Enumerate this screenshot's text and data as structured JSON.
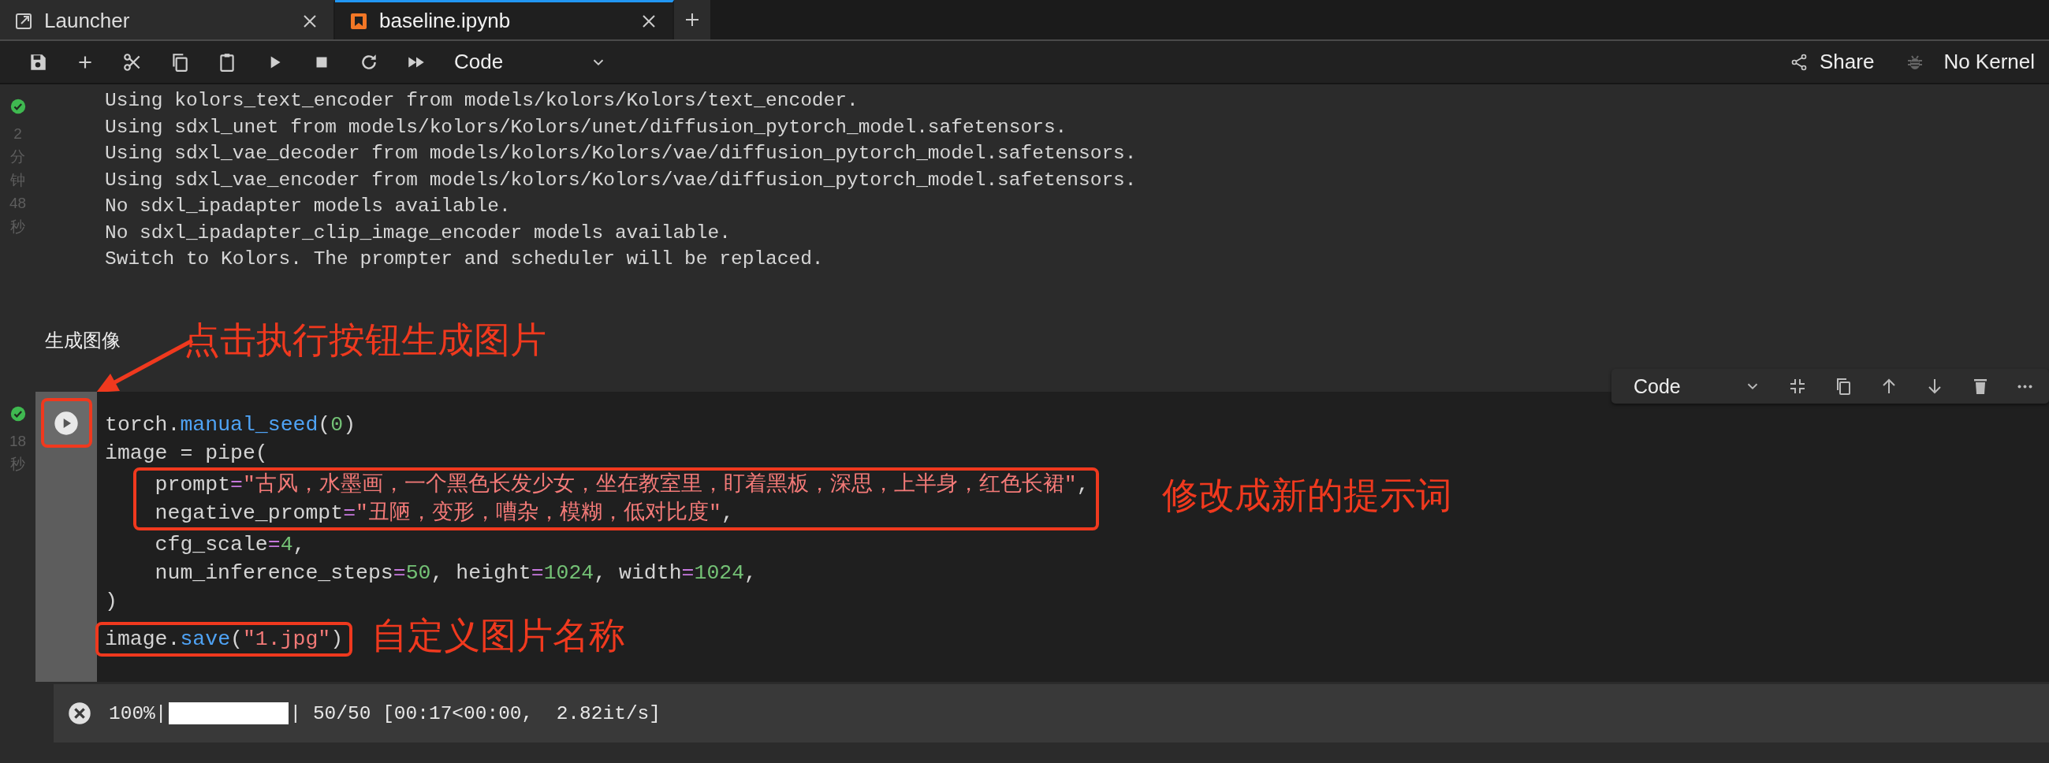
{
  "tabs": [
    {
      "label": "Launcher",
      "kind": "launcher",
      "selected": false
    },
    {
      "label": "baseline.ipynb",
      "kind": "notebook",
      "selected": true
    }
  ],
  "toolbar": {
    "cell_type": "Code",
    "share": "Share",
    "kernel": "No Kernel"
  },
  "output_cell": {
    "completed": true,
    "time": "2分钟48秒",
    "lines": [
      "Using kolors_text_encoder from models/kolors/Kolors/text_encoder.",
      "Using sdxl_unet from models/kolors/Kolors/unet/diffusion_pytorch_model.safetensors.",
      "Using sdxl_vae_decoder from models/kolors/Kolors/vae/diffusion_pytorch_model.safetensors.",
      "Using sdxl_vae_encoder from models/kolors/Kolors/vae/diffusion_pytorch_model.safetensors.",
      "No sdxl_ipadapter models available.",
      "No sdxl_ipadapter_clip_image_encoder models available.",
      "Switch to Kolors. The prompter and scheduler will be replaced."
    ]
  },
  "markdown_cell": {
    "heading": "生成图像",
    "note": "点击执行按钮生成图片"
  },
  "code_cell": {
    "completed": true,
    "time": "18秒",
    "cell_type": "Code",
    "blocks": [
      {
        "highlighted": false,
        "lines": [
          [
            {
              "text": "torch.",
              "kind": "plain"
            },
            {
              "text": "manual_seed",
              "kind": "func"
            },
            {
              "text": "(",
              "kind": "plain"
            },
            {
              "text": "0",
              "kind": "number"
            },
            {
              "text": ")",
              "kind": "plain"
            }
          ],
          [
            {
              "text": "image = pipe(",
              "kind": "plain"
            }
          ]
        ]
      },
      {
        "highlighted": true,
        "note": "修改成新的提示词",
        "lines": [
          [
            {
              "text": "    prompt",
              "kind": "plain"
            },
            {
              "text": "=",
              "kind": "op"
            },
            {
              "text": "\"古风，水墨画，一个黑色长发少女，坐在教室里，盯着黑板，深思，上半身，红色长裙\"",
              "kind": "string"
            },
            {
              "text": ",",
              "kind": "plain"
            }
          ],
          [
            {
              "text": "    negative_prompt",
              "kind": "plain"
            },
            {
              "text": "=",
              "kind": "op"
            },
            {
              "text": "\"丑陋，变形，嘈杂，模糊，低对比度\"",
              "kind": "string"
            },
            {
              "text": ",",
              "kind": "plain"
            }
          ]
        ]
      },
      {
        "highlighted": false,
        "lines": [
          [
            {
              "text": "    cfg_scale",
              "kind": "plain"
            },
            {
              "text": "=",
              "kind": "op"
            },
            {
              "text": "4",
              "kind": "number"
            },
            {
              "text": ",",
              "kind": "plain"
            }
          ],
          [
            {
              "text": "    num_inference_steps",
              "kind": "plain"
            },
            {
              "text": "=",
              "kind": "op"
            },
            {
              "text": "50",
              "kind": "number"
            },
            {
              "text": ", height",
              "kind": "plain"
            },
            {
              "text": "=",
              "kind": "op"
            },
            {
              "text": "1024",
              "kind": "number"
            },
            {
              "text": ", width",
              "kind": "plain"
            },
            {
              "text": "=",
              "kind": "op"
            },
            {
              "text": "1024",
              "kind": "number"
            },
            {
              "text": ",",
              "kind": "plain"
            }
          ],
          [
            {
              "text": ")",
              "kind": "plain"
            }
          ]
        ]
      },
      {
        "highlighted": true,
        "note": "自定义图片名称",
        "lines": [
          [
            {
              "text": "image.",
              "kind": "plain"
            },
            {
              "text": "save",
              "kind": "func"
            },
            {
              "text": "(",
              "kind": "plain"
            },
            {
              "text": "\"1.jpg\"",
              "kind": "string"
            },
            {
              "text": ")",
              "kind": "plain"
            }
          ]
        ]
      }
    ]
  },
  "progress": {
    "percent": "100%|",
    "level": 1,
    "tail": "| 50/50 [00:17<00:00,  2.82it/s]"
  }
}
